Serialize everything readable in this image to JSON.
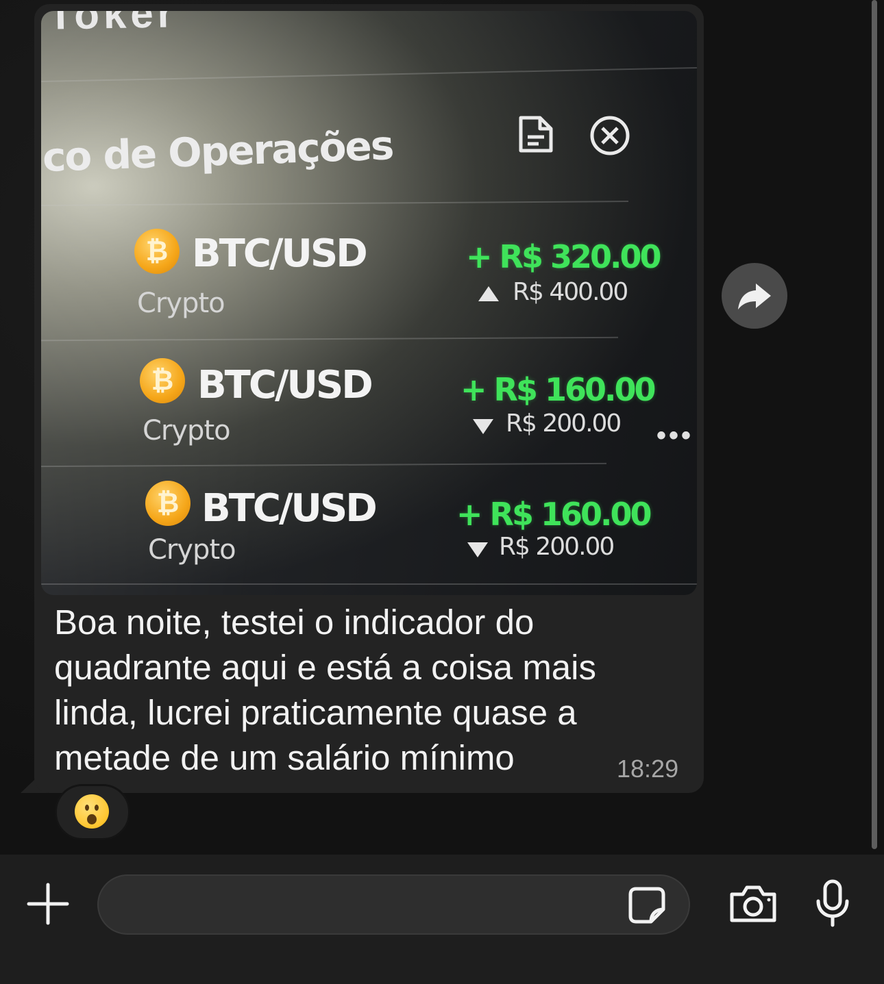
{
  "message": {
    "photo": {
      "top_fragment": "Toker ",
      "panel_title": "co de Operações",
      "trades": [
        {
          "coin_symbol": "₿",
          "pair": "BTC/USD",
          "category": "Crypto",
          "profit": "+ R$ 320.00",
          "direction": "up",
          "stake": "R$ 400.00"
        },
        {
          "coin_symbol": "₿",
          "pair": "BTC/USD",
          "category": "Crypto",
          "profit": "+ R$ 160.00",
          "direction": "down",
          "stake": "R$ 200.00"
        },
        {
          "coin_symbol": "₿",
          "pair": "BTC/USD",
          "category": "Crypto",
          "profit": "+ R$ 160.00",
          "direction": "down",
          "stake": "R$ 200.00"
        }
      ],
      "more_dots": "•••"
    },
    "text": "Boa noite, testei o indicador do quadrante aqui e está a coisa mais linda, lucrei praticamente quase a metade de um salário mínimo",
    "time": "18:29",
    "reaction_emoji": "surprised-face"
  },
  "composer": {
    "value": "",
    "placeholder": ""
  },
  "icons": {
    "forward": "forward-arrow-icon",
    "attach": "plus-icon",
    "sticker": "sticker-icon",
    "camera": "camera-icon",
    "mic": "microphone-icon"
  },
  "colors": {
    "profit_green": "#3fe35a",
    "bubble_bg": "#232323",
    "coin_orange": "#f5a619"
  }
}
